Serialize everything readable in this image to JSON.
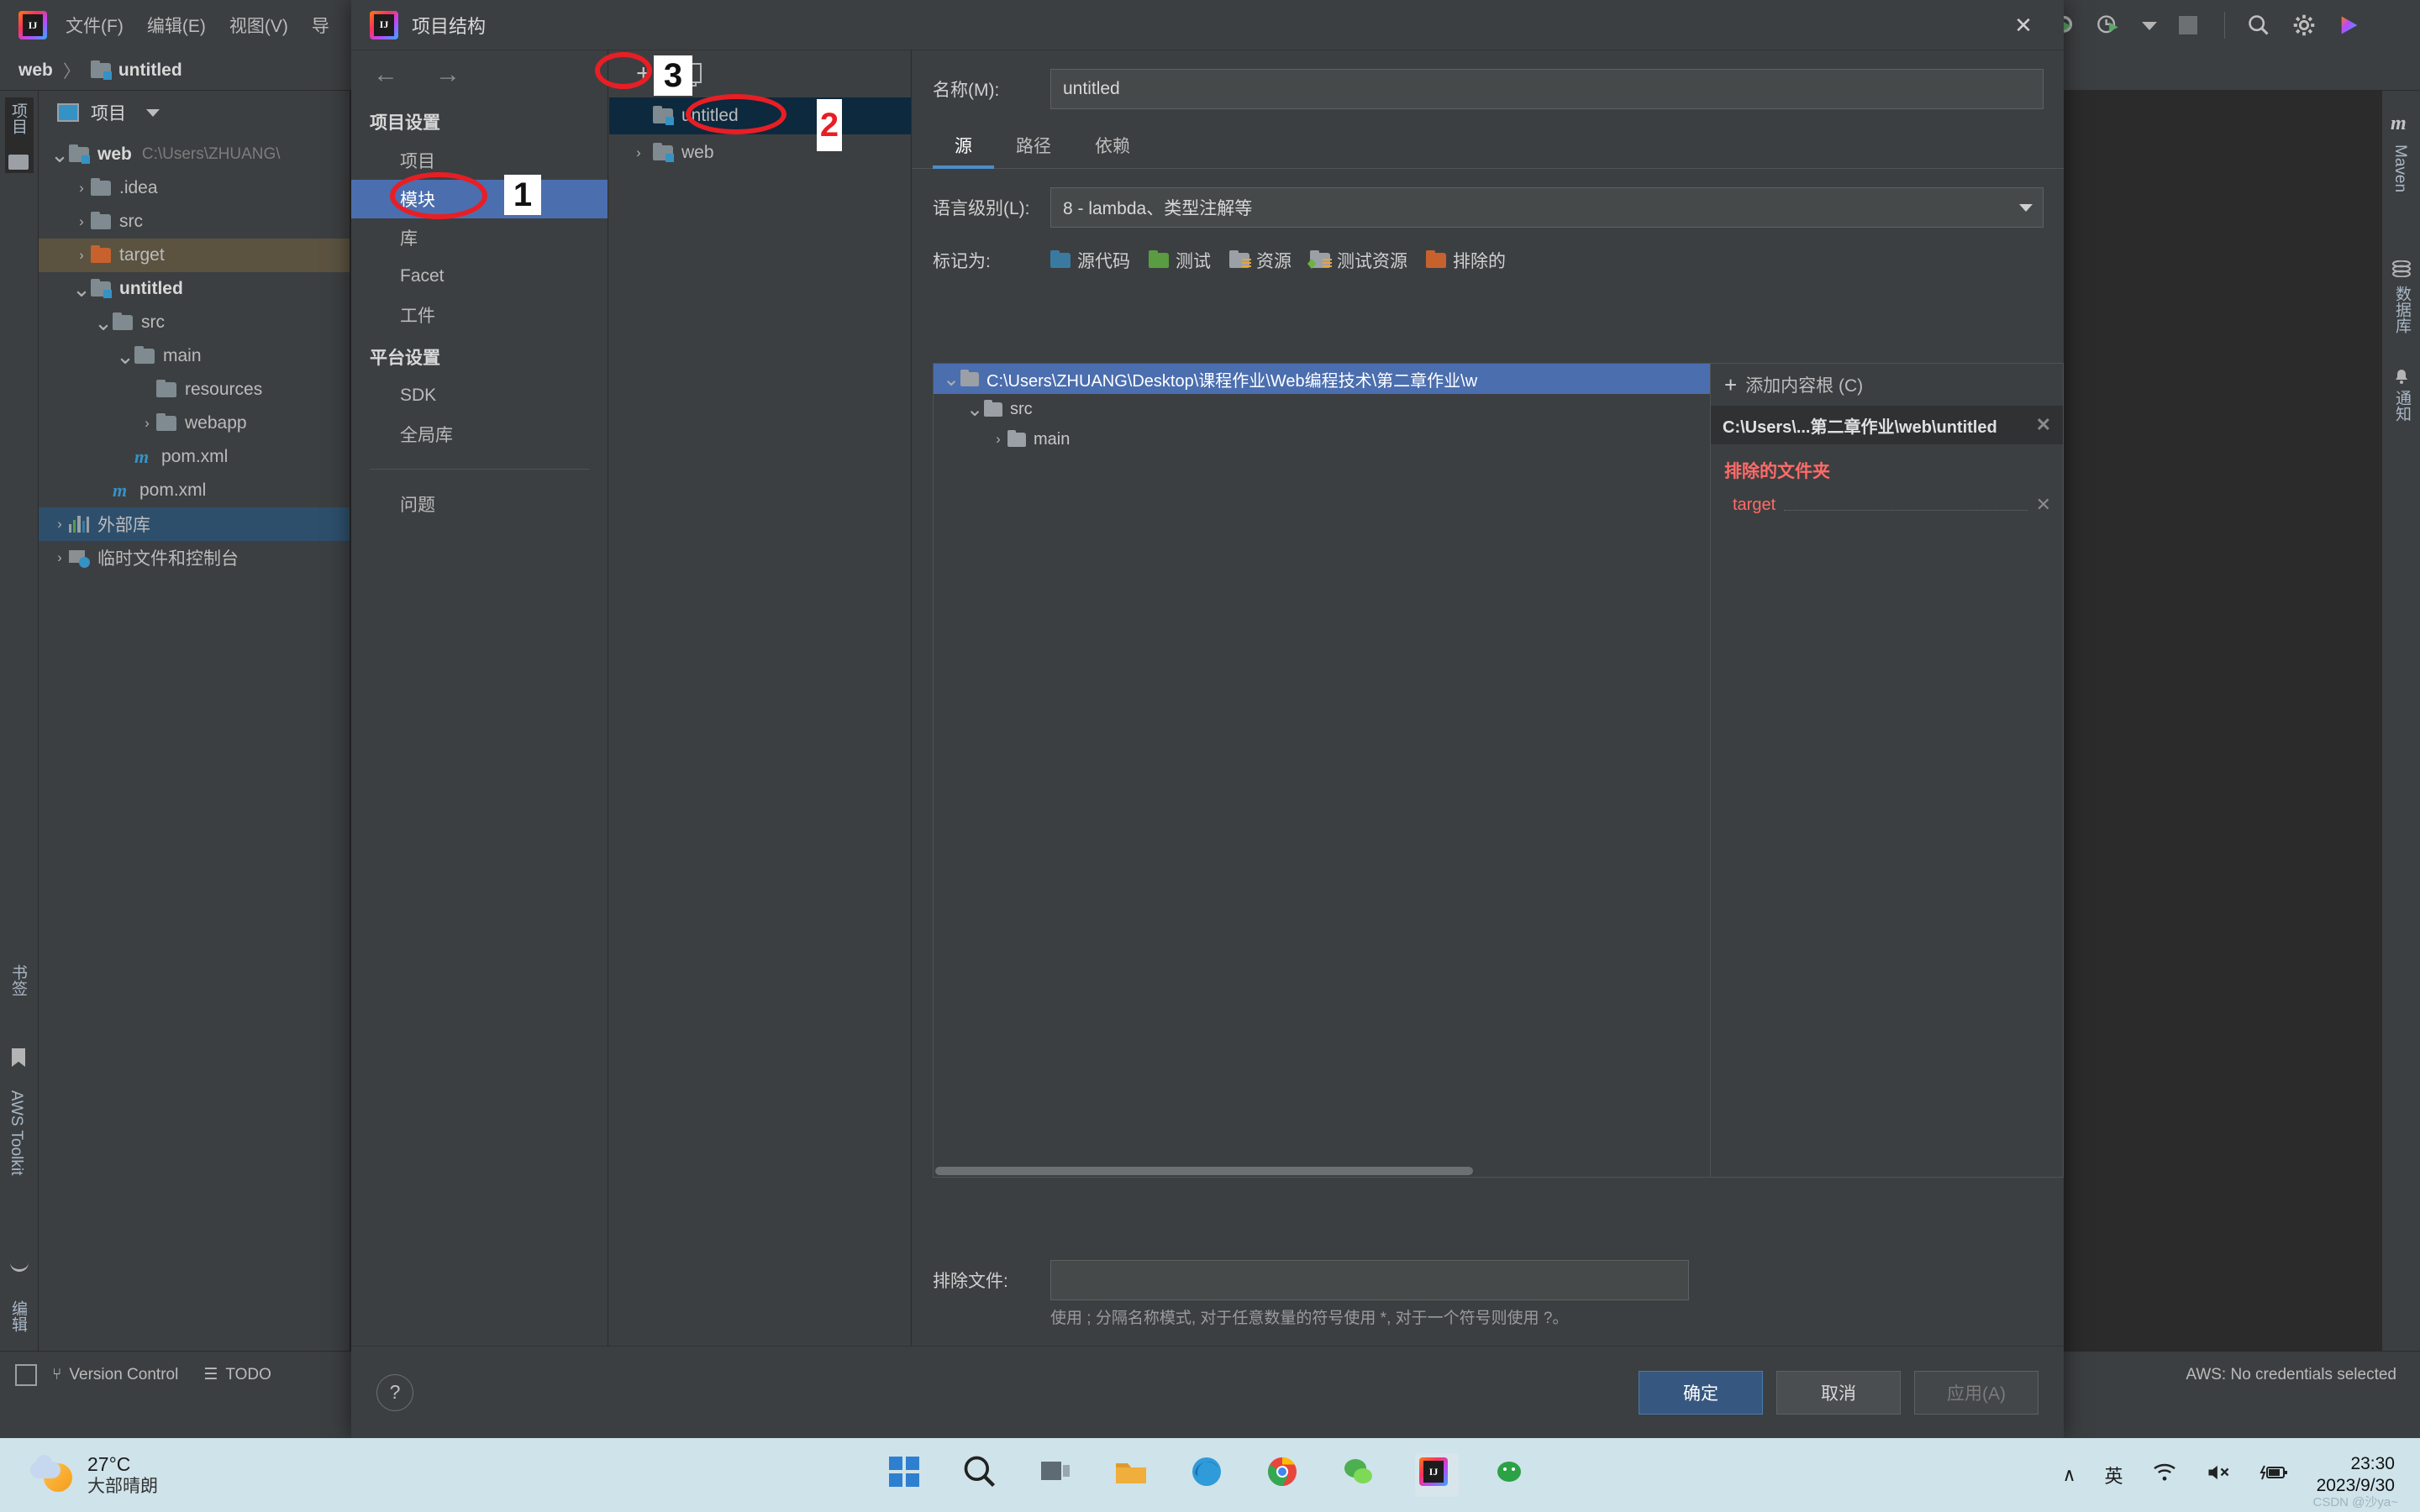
{
  "ide": {
    "menu_items": [
      "文件(F)",
      "编辑(E)",
      "视图(V)",
      "导"
    ],
    "breadcrumb": {
      "project": "web",
      "separator": "〉",
      "module": "untitled"
    },
    "left_strip": {
      "project_label": "项目",
      "bookmarks_label": "书签",
      "aws_label": "AWS Toolkit",
      "edit_label": "编辑"
    },
    "project_panel": {
      "header": "项目",
      "tree": [
        {
          "label": "web",
          "suffix": "C:\\Users\\ZHUANG\\",
          "icon": "module-folder-icon",
          "arrow": "expanded",
          "depth": 0,
          "bold": true,
          "state": "none"
        },
        {
          "label": ".idea",
          "suffix": "",
          "icon": "folder-icon",
          "arrow": "collapsed",
          "depth": 1,
          "bold": false,
          "state": "none"
        },
        {
          "label": "src",
          "suffix": "",
          "icon": "folder-icon",
          "arrow": "collapsed",
          "depth": 1,
          "bold": false,
          "state": "none"
        },
        {
          "label": "target",
          "suffix": "",
          "icon": "folder-excluded-icon",
          "arrow": "collapsed",
          "depth": 1,
          "bold": false,
          "state": "brown"
        },
        {
          "label": "untitled",
          "suffix": "",
          "icon": "module-folder-icon",
          "arrow": "expanded",
          "depth": 1,
          "bold": true,
          "state": "none"
        },
        {
          "label": "src",
          "suffix": "",
          "icon": "folder-icon",
          "arrow": "expanded",
          "depth": 2,
          "bold": false,
          "state": "none"
        },
        {
          "label": "main",
          "suffix": "",
          "icon": "folder-icon",
          "arrow": "expanded",
          "depth": 3,
          "bold": false,
          "state": "none"
        },
        {
          "label": "resources",
          "suffix": "",
          "icon": "folder-icon",
          "arrow": "none",
          "depth": 4,
          "bold": false,
          "state": "none"
        },
        {
          "label": "webapp",
          "suffix": "",
          "icon": "folder-icon",
          "arrow": "collapsed",
          "depth": 4,
          "bold": false,
          "state": "none"
        },
        {
          "label": "pom.xml",
          "suffix": "",
          "icon": "maven-icon",
          "arrow": "none",
          "depth": 3,
          "bold": false,
          "state": "none"
        },
        {
          "label": "pom.xml",
          "suffix": "",
          "icon": "maven-icon",
          "arrow": "none",
          "depth": 2,
          "bold": false,
          "state": "none"
        },
        {
          "label": "外部库",
          "suffix": "",
          "icon": "library-icon",
          "arrow": "collapsed",
          "depth": 0,
          "bold": false,
          "state": "blue"
        },
        {
          "label": "临时文件和控制台",
          "suffix": "",
          "icon": "scratches-icon",
          "arrow": "collapsed",
          "depth": 0,
          "bold": false,
          "state": "none"
        }
      ]
    },
    "right_strip": {
      "maven": "Maven",
      "database": "数据库",
      "notifications": "通知"
    },
    "status_bar": {
      "version_control": "Version Control",
      "todo": "TODO",
      "aws_status": "AWS: No credentials selected"
    }
  },
  "dialog": {
    "title": "项目结构",
    "close_label": "✕",
    "nav": {
      "back": "←",
      "forward": "→"
    },
    "sidebar": {
      "project_settings_group": "项目设置",
      "project_settings_items": [
        "项目",
        "模块",
        "库",
        "Facet",
        "工件"
      ],
      "active_item": "模块",
      "platform_settings_group": "平台设置",
      "platform_settings_items": [
        "SDK",
        "全局库"
      ],
      "problems_item": "问题"
    },
    "module_tree": {
      "add_label": "+",
      "copy_label": "copy-module-icon",
      "items": [
        {
          "label": "untitled",
          "selected": true,
          "arrow": "none"
        },
        {
          "label": "web",
          "selected": false,
          "arrow": "collapsed"
        }
      ]
    },
    "main": {
      "name_label": "名称(M):",
      "name_value": "untitled",
      "tabs": [
        {
          "label": "源",
          "active": true
        },
        {
          "label": "路径",
          "active": false
        },
        {
          "label": "依赖",
          "active": false
        }
      ],
      "language_level_label": "语言级别(L):",
      "language_level_value": "8 - lambda、类型注解等",
      "mark_as_label": "标记为:",
      "mark_as_options": [
        {
          "label": "源代码",
          "color": "#3b7aa0",
          "kind": "plain"
        },
        {
          "label": "测试",
          "color": "#5a9c41",
          "kind": "plain"
        },
        {
          "label": "资源",
          "color": "#9aa0a6",
          "kind": "resource"
        },
        {
          "label": "测试资源",
          "color": "#9aa0a6",
          "kind": "test-resource"
        },
        {
          "label": "排除的",
          "color": "#c7622e",
          "kind": "plain"
        }
      ],
      "content_tree": [
        {
          "label": "C:\\Users\\ZHUANG\\Desktop\\课程作业\\Web编程技术\\第二章作业\\w",
          "depth": 0,
          "arrow": "expanded",
          "selected": true
        },
        {
          "label": "src",
          "depth": 1,
          "arrow": "expanded",
          "selected": false
        },
        {
          "label": "main",
          "depth": 2,
          "arrow": "collapsed",
          "selected": false
        }
      ],
      "add_content_root": "添加内容根 (C)",
      "add_content_root_plus": "+",
      "content_root_path": "C:\\Users\\...第二章作业\\web\\untitled",
      "excluded_header": "排除的文件夹",
      "excluded_items": [
        "target"
      ],
      "remove_glyph": "✕",
      "exclude_files_label": "排除文件:",
      "exclude_files_value": "",
      "exclude_hint": "使用 ; 分隔名称模式, 对于任意数量的符号使用 *, 对于一个符号则使用 ?。"
    },
    "footer": {
      "help_label": "?",
      "ok_label": "确定",
      "cancel_label": "取消",
      "apply_label": "应用(A)"
    }
  },
  "annotations": [
    {
      "id": "1",
      "shape": "ellipse",
      "target": "sidebar-item-modules"
    },
    {
      "id": "2",
      "shape": "ellipse",
      "target": "module-untitled"
    },
    {
      "id": "3",
      "shape": "ellipse",
      "target": "add-module-button"
    }
  ],
  "taskbar": {
    "weather_temp": "27°C",
    "weather_desc": "大部晴朗",
    "time": "23:30",
    "date": "2023/9/30",
    "ime_label": "英",
    "chevron": "∧",
    "watermark": "CSDN @沙ya~"
  }
}
